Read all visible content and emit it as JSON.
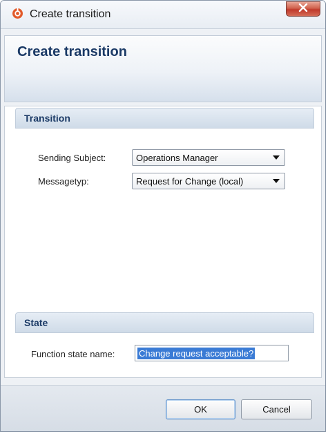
{
  "window": {
    "title": "Create transition",
    "close_icon": "close-x-icon",
    "app_icon": "app-logo-icon"
  },
  "header": {
    "title": "Create transition"
  },
  "transition_section": {
    "title": "Transition",
    "sending_subject": {
      "label": "Sending Subject:",
      "value": "Operations Manager"
    },
    "messagetyp": {
      "label": "Messagetyp:",
      "value": "Request for Change (local)"
    }
  },
  "state_section": {
    "title": "State",
    "function_state_name": {
      "label": "Function state name:",
      "value": "Change request acceptable?"
    }
  },
  "buttons": {
    "ok_label": "OK",
    "cancel_label": "Cancel"
  },
  "colors": {
    "accent": "#1b3a66",
    "close_button": "#c0392b",
    "selection": "#3a7bd5"
  }
}
